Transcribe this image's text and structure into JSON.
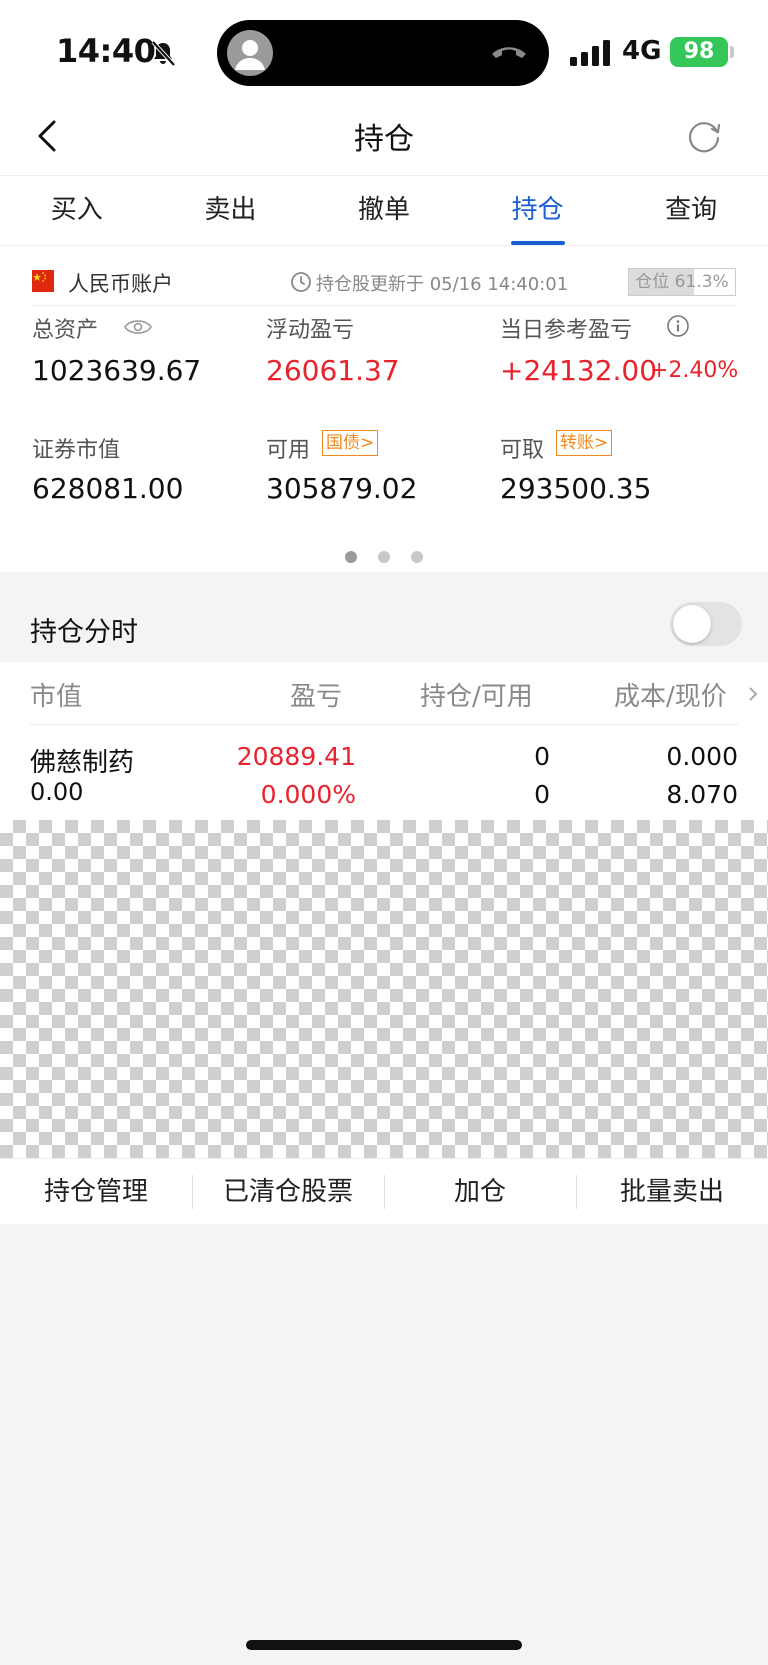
{
  "status_bar": {
    "time": "14:40",
    "network": "4G",
    "battery": "98"
  },
  "nav": {
    "title": "持仓"
  },
  "tabs": [
    {
      "label": "买入"
    },
    {
      "label": "卖出"
    },
    {
      "label": "撤单"
    },
    {
      "label": "持仓",
      "active": true
    },
    {
      "label": "查询"
    }
  ],
  "account": {
    "name": "人民币账户",
    "update_text": "持仓股更新于 05/16 14:40:01",
    "position_ratio": {
      "label": "仓位 61.3%",
      "value": 0.613
    },
    "total_assets": {
      "label": "总资产",
      "value": "1023639.67"
    },
    "floating_pl": {
      "label": "浮动盈亏",
      "value": "26061.37"
    },
    "daily_pl": {
      "label": "当日参考盈亏",
      "value": "+24132.00",
      "change": "+2.40%"
    },
    "securities_value": {
      "label": "证券市值",
      "value": "628081.00"
    },
    "available": {
      "label": "可用",
      "tag": "国债>",
      "value": "305879.02"
    },
    "withdrawable": {
      "label": "可取",
      "tag": "转账>",
      "value": "293500.35"
    },
    "pages": 3,
    "active_page": 1
  },
  "holdings": {
    "section_title": "持仓分时",
    "toggle_on": false,
    "columns": [
      "市值",
      "盈亏",
      "持仓/可用",
      "成本/现价"
    ],
    "rows": [
      {
        "name": "佛慈制药",
        "market_value": "0.00",
        "profit": "20889.41",
        "profit_pct": "0.000%",
        "holding": "0",
        "available": "0",
        "cost": "0.000",
        "price": "8.070"
      }
    ]
  },
  "actions": [
    "持仓管理",
    "已清仓股票",
    "加仓",
    "批量卖出"
  ],
  "colors": {
    "accent": "#1a5fd0",
    "up": "#e8232b",
    "tag": "#f08a1e",
    "battery": "#34c759"
  }
}
